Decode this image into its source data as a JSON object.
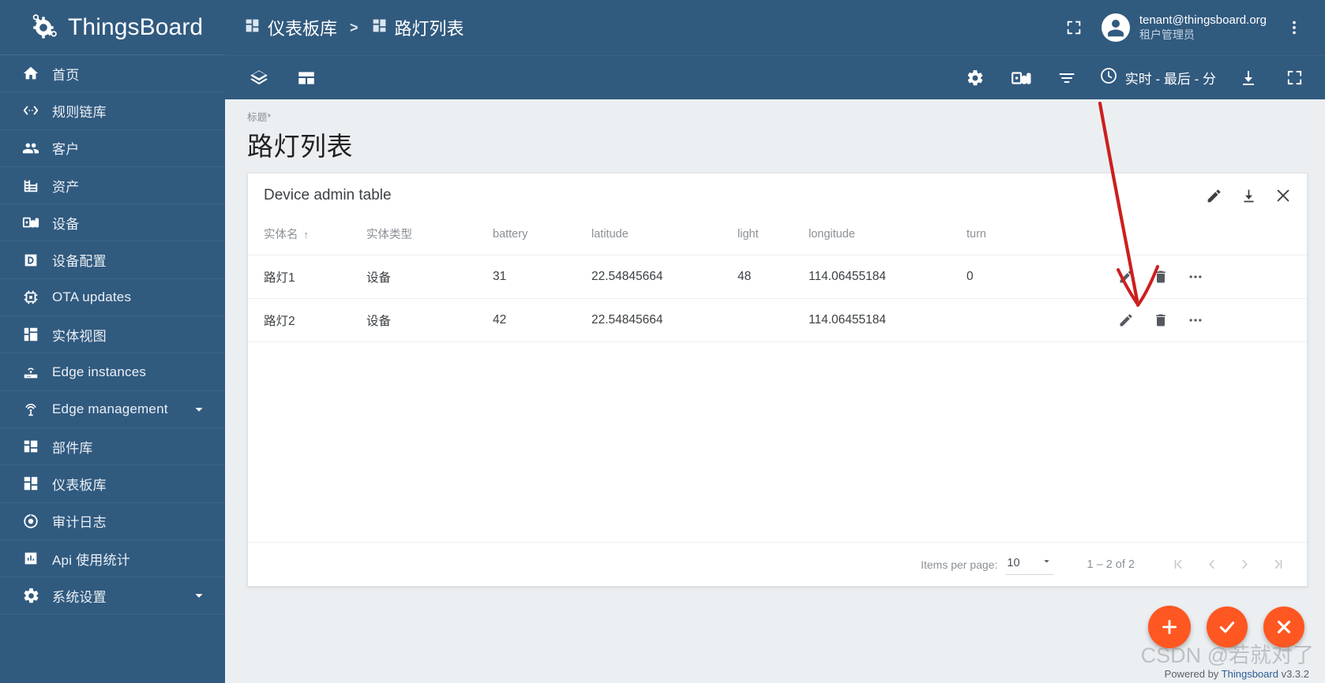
{
  "brand": {
    "name": "ThingsBoard",
    "logo_icon": "thingsboard-logo-icon"
  },
  "sidebar": {
    "items": [
      {
        "label": "首页",
        "icon": "home-icon",
        "expandable": false
      },
      {
        "label": "规则链库",
        "icon": "rule-chain-icon",
        "expandable": false
      },
      {
        "label": "客户",
        "icon": "customers-icon",
        "expandable": false
      },
      {
        "label": "资产",
        "icon": "assets-icon",
        "expandable": false
      },
      {
        "label": "设备",
        "icon": "devices-icon",
        "expandable": false
      },
      {
        "label": "设备配置",
        "icon": "device-profiles-icon",
        "expandable": false
      },
      {
        "label": "OTA updates",
        "icon": "ota-updates-icon",
        "expandable": false
      },
      {
        "label": "实体视图",
        "icon": "entity-views-icon",
        "expandable": false
      },
      {
        "label": "Edge instances",
        "icon": "edge-instances-icon",
        "expandable": false
      },
      {
        "label": "Edge management",
        "icon": "edge-management-icon",
        "expandable": true
      },
      {
        "label": "部件库",
        "icon": "widget-library-icon",
        "expandable": false
      },
      {
        "label": "仪表板库",
        "icon": "dashboards-icon",
        "expandable": false
      },
      {
        "label": "审计日志",
        "icon": "audit-logs-icon",
        "expandable": false
      },
      {
        "label": "Api 使用统计",
        "icon": "api-usage-icon",
        "expandable": false
      },
      {
        "label": "系统设置",
        "icon": "settings-icon",
        "expandable": true
      }
    ]
  },
  "topbar": {
    "breadcrumb": [
      {
        "label": "仪表板库",
        "icon": "dashboards-icon"
      },
      {
        "label": "路灯列表",
        "icon": "dashboards-icon"
      }
    ],
    "separator": ">",
    "fullscreen_icon": "fullscreen-icon",
    "user": {
      "email": "tenant@thingsboard.org",
      "role": "租户管理员",
      "avatar_icon": "account-circle-icon"
    },
    "more_icon": "more-vert-icon"
  },
  "dashboard_toolbar": {
    "layers_icon": "layers-icon",
    "layout_icon": "dashboard-layout-icon",
    "settings_icon": "gear-icon",
    "states_icon": "device-states-icon",
    "filters_icon": "filter-icon",
    "timewindow": {
      "clock_icon": "clock-icon",
      "label": "实时 - 最后 - 分"
    },
    "export_icon": "download-icon",
    "fullscreen_icon": "fullscreen-icon"
  },
  "page": {
    "title_label": "标题",
    "title_required_mark": "*",
    "title_value": "路灯列表"
  },
  "widget": {
    "title": "Device admin table",
    "actions": [
      {
        "name": "edit-widget-button",
        "icon": "pencil-icon"
      },
      {
        "name": "export-widget-button",
        "icon": "download-icon"
      },
      {
        "name": "remove-widget-button",
        "icon": "close-icon"
      }
    ],
    "table": {
      "columns": [
        {
          "label": "实体名",
          "sorted": true,
          "sort_arrow": "↑"
        },
        {
          "label": "实体类型",
          "sorted": false,
          "sort_arrow": ""
        },
        {
          "label": "battery",
          "sorted": false,
          "sort_arrow": ""
        },
        {
          "label": "latitude",
          "sorted": false,
          "sort_arrow": ""
        },
        {
          "label": "light",
          "sorted": false,
          "sort_arrow": ""
        },
        {
          "label": "longitude",
          "sorted": false,
          "sort_arrow": ""
        },
        {
          "label": "turn",
          "sorted": false,
          "sort_arrow": ""
        },
        {
          "label": "",
          "sorted": false,
          "sort_arrow": ""
        }
      ],
      "rows": [
        {
          "name": "路灯1",
          "type": "设备",
          "battery": "31",
          "latitude": "22.54845664",
          "light": "48",
          "longitude": "114.06455184",
          "turn": "0"
        },
        {
          "name": "路灯2",
          "type": "设备",
          "battery": "42",
          "latitude": "22.54845664",
          "light": "",
          "longitude": "114.06455184",
          "turn": ""
        }
      ],
      "row_actions": [
        {
          "name": "row-edit-button",
          "icon": "pencil-icon"
        },
        {
          "name": "row-delete-button",
          "icon": "trash-icon"
        },
        {
          "name": "row-more-button",
          "icon": "more-horiz-icon"
        }
      ]
    },
    "paginator": {
      "items_per_page_label": "Items per page:",
      "items_per_page_value": "10",
      "range_label": "1 – 2 of 2",
      "buttons": [
        {
          "name": "first-page-button",
          "glyph": "|<"
        },
        {
          "name": "previous-page-button",
          "glyph": "<"
        },
        {
          "name": "next-page-button",
          "glyph": ">"
        },
        {
          "name": "last-page-button",
          "glyph": ">|"
        }
      ]
    }
  },
  "fabs": [
    {
      "name": "add-widget-fab",
      "icon": "plus-icon",
      "glyph": "+",
      "color": "#ff5722"
    },
    {
      "name": "apply-changes-fab",
      "icon": "check-icon",
      "glyph": "✓",
      "color": "#ff5722"
    },
    {
      "name": "cancel-changes-fab",
      "icon": "close-icon",
      "glyph": "✕",
      "color": "#ff5722"
    }
  ],
  "footer": {
    "prefix": "Powered by ",
    "link_text": "Thingsboard",
    "version": " v3.3.2"
  },
  "watermark": {
    "text": "CSDN @若就对了"
  },
  "colors": {
    "sidebar_bg": "#315a7f",
    "accent": "#ff5722",
    "page_bg": "#eceff1",
    "widget_bg": "#ffffff",
    "annotation_red": "#cc1f1f"
  }
}
